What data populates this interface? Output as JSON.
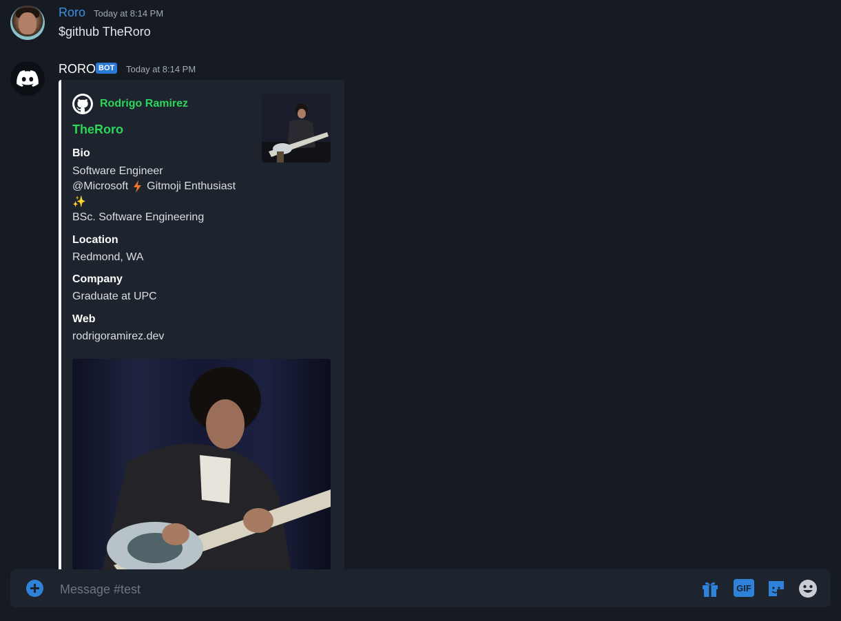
{
  "messages": {
    "user": {
      "name": "Roro",
      "timestamp": "Today at 8:14 PM",
      "text": "$github TheRoro"
    },
    "bot": {
      "name": "RORO",
      "badge": "BOT",
      "timestamp": "Today at 8:14 PM"
    }
  },
  "embed": {
    "author": "Rodrigo Ramirez",
    "title": "TheRoro",
    "fields": {
      "bio": {
        "name": "Bio",
        "lines": [
          "Software Engineer",
          "@Microsoft",
          "Gitmoji Enthusiast",
          "✨",
          "BSc. Software Engineering"
        ]
      },
      "location": {
        "name": "Location",
        "value": "Redmond, WA"
      },
      "company": {
        "name": "Company",
        "value": "Graduate at UPC"
      },
      "web": {
        "name": "Web",
        "value": "rodrigoramirez.dev"
      }
    }
  },
  "composer": {
    "placeholder": "Message #test",
    "gif_label": "GIF"
  },
  "icons": {
    "add": "plus-circle-icon",
    "gift": "gift-icon",
    "gif": "gif-icon",
    "sticker": "sticker-icon",
    "emoji": "smiley-icon",
    "author": "github-icon"
  },
  "colors": {
    "background": "#151a23",
    "embed_bg": "#1e242d",
    "accent_blue": "#2f82d9",
    "embed_green": "#2bd65b",
    "username_blue": "#3c90e6"
  }
}
